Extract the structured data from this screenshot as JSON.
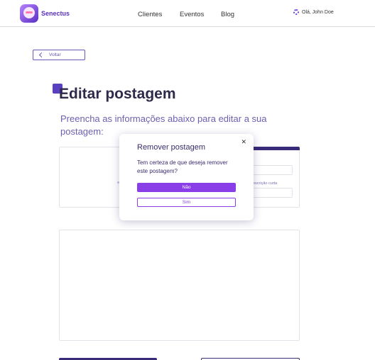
{
  "header": {
    "logo_text": "Senectus",
    "nav": [
      "Clientes",
      "Eventos",
      "Blog"
    ],
    "greeting": "Olá, John Doe"
  },
  "back_label": "Voltar",
  "page": {
    "title": "Editar postagem",
    "subtitle": "Preencha as informações abaixo para editar a sua postagem:",
    "field_label": "Descrição curta"
  },
  "modal": {
    "title": "Remover postagem",
    "text": "Tem certeza de que deseja remover este postagem?",
    "no_label": "Não",
    "yes_label": "Sim",
    "close_glyph": "✕"
  },
  "colors": {
    "accent": "#8a3ee8",
    "brand_dark": "#3a2a7a"
  }
}
